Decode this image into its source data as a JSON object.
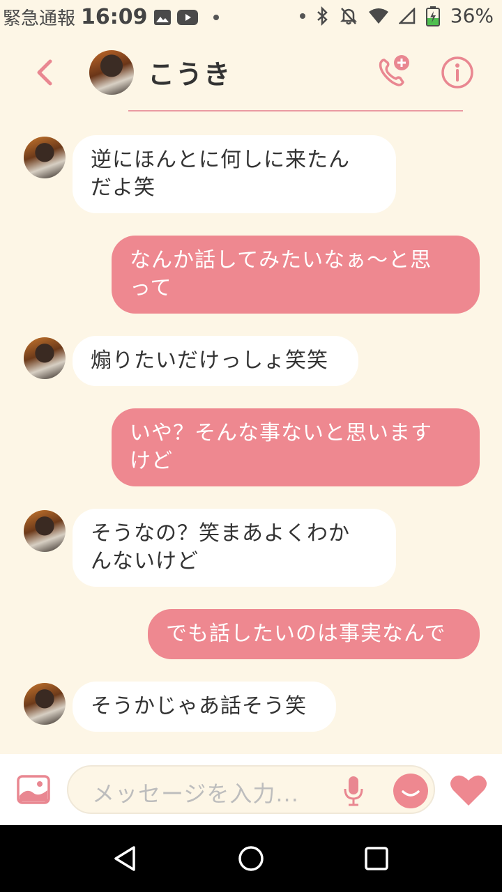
{
  "status_bar": {
    "left_text": "緊急通報",
    "time": "16:09",
    "battery": "36%"
  },
  "header": {
    "contact_name": "こうき"
  },
  "messages": [
    {
      "side": "in",
      "text": "逆にほんとに何しに来たん\nだよ笑"
    },
    {
      "side": "out",
      "text": "なんか話してみたいなぁ〜と思\nって"
    },
    {
      "side": "in",
      "text": "煽りたいだけっしょ笑笑"
    },
    {
      "side": "out",
      "text": "いや？そんな事ないと思います\nけど"
    },
    {
      "side": "in",
      "text": "そうなの？笑まあよくわか\nんないけど"
    },
    {
      "side": "out",
      "text": "でも話したいのは事実なんで"
    },
    {
      "side": "in",
      "text": "そうかじゃあ話そう笑"
    }
  ],
  "input": {
    "placeholder": "メッセージを入力..."
  },
  "colors": {
    "accent": "#ee8890",
    "background": "#fdf6e6",
    "incoming_bubble": "#ffffff",
    "outgoing_bubble": "#ee8890"
  },
  "icons": {
    "back": "chevron-left-icon",
    "call": "phone-add-icon",
    "info": "info-icon",
    "image": "image-icon",
    "mic": "microphone-icon",
    "emoji": "smile-icon",
    "like": "heart-icon"
  }
}
